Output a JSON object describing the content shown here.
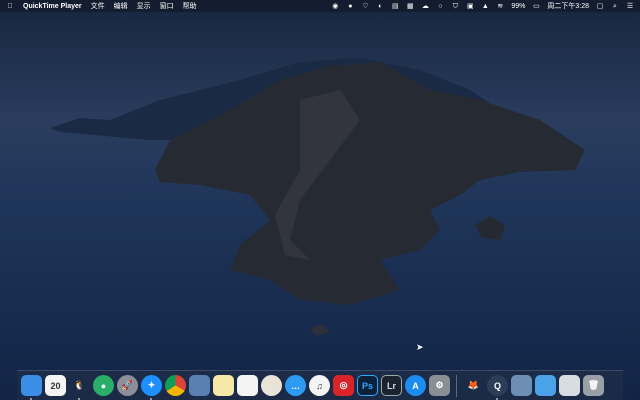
{
  "menubar": {
    "app_name": "QuickTime Player",
    "menus": [
      "文件",
      "编辑",
      "显示",
      "窗口",
      "帮助"
    ],
    "battery": "99%",
    "clock": "周二下午3:28"
  },
  "dock": {
    "items": [
      {
        "name": "finder",
        "label": "",
        "color": "#3a8ee6",
        "running": true
      },
      {
        "name": "calendar",
        "label": "20",
        "color": "#f4f4f4"
      },
      {
        "name": "qq",
        "label": "🐧",
        "color": "transparent",
        "running": true
      },
      {
        "name": "wechat",
        "label": "●",
        "color": "#2aae67"
      },
      {
        "name": "launchpad",
        "label": "🚀",
        "color": "#8a8f99"
      },
      {
        "name": "safari",
        "label": "✦",
        "color": "#1e8fff",
        "running": true
      },
      {
        "name": "chrome",
        "label": "",
        "color": "conic"
      },
      {
        "name": "preview",
        "label": "",
        "color": "#5b7fb0"
      },
      {
        "name": "notes",
        "label": "",
        "color": "#f6e9a8"
      },
      {
        "name": "reminders",
        "label": "",
        "color": "#f4f4f4"
      },
      {
        "name": "photos",
        "label": "",
        "color": "#e9e3d8"
      },
      {
        "name": "messages",
        "label": "…",
        "color": "#2e9bf3"
      },
      {
        "name": "itunes",
        "label": "♫",
        "color": "#f4f4f4"
      },
      {
        "name": "netease-music",
        "label": "◎",
        "color": "#d9252a"
      },
      {
        "name": "photoshop",
        "label": "Ps",
        "color": "#0c2038"
      },
      {
        "name": "lightroom",
        "label": "Lr",
        "color": "#1c2330"
      },
      {
        "name": "app-store",
        "label": "A",
        "color": "#1b8df0"
      },
      {
        "name": "system-preferences",
        "label": "⚙",
        "color": "#8a8f96"
      },
      {
        "sep": true
      },
      {
        "name": "gitlab",
        "label": "🦊",
        "color": "transparent"
      },
      {
        "name": "quicktime",
        "label": "Q",
        "color": "#2b3d58",
        "running": true
      },
      {
        "name": "image-capture",
        "label": "",
        "color": "#6c8fb3"
      },
      {
        "name": "downloads-folder",
        "label": "",
        "color": "#4aa3e6"
      },
      {
        "name": "screen-sharing",
        "label": "",
        "color": "#d8dde4"
      },
      {
        "name": "trash",
        "label": "🗑",
        "color": "#9aa0a8"
      }
    ]
  }
}
